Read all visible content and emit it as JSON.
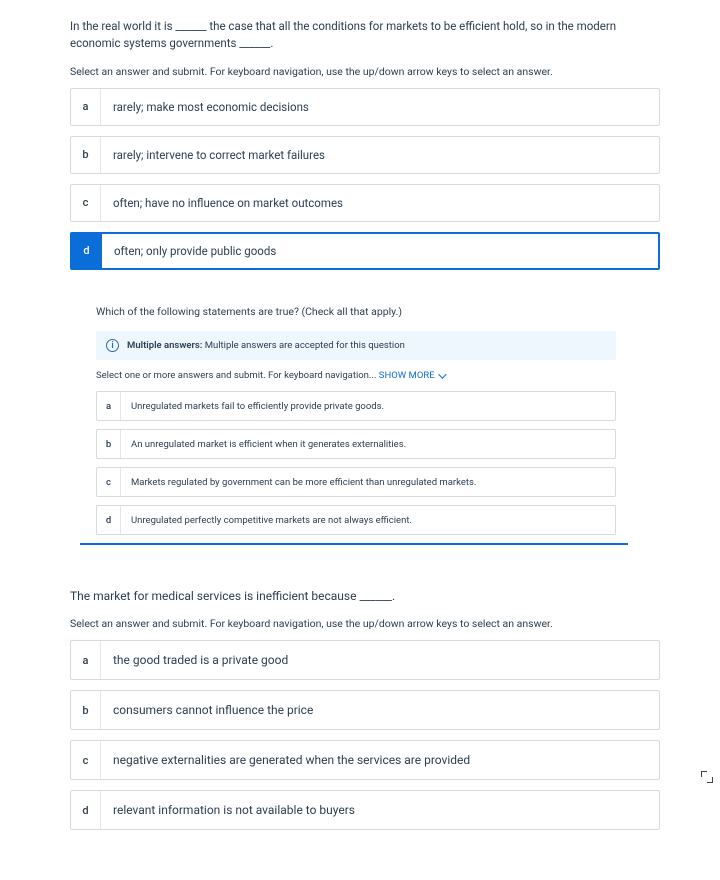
{
  "q1": {
    "prompt": "In the real world it is ______ the case that all the conditions for markets to be efficient hold, so in the modern economic systems governments ______.",
    "instructions": "Select an answer and submit. For keyboard navigation, use the up/down arrow keys to select an answer.",
    "options": {
      "a": {
        "letter": "a",
        "text": "rarely; make most economic decisions"
      },
      "b": {
        "letter": "b",
        "text": "rarely; intervene to correct market failures"
      },
      "c": {
        "letter": "c",
        "text": "often; have no influence on market outcomes"
      },
      "d": {
        "letter": "d",
        "text": "often; only provide public goods"
      }
    },
    "selected": "d"
  },
  "q2": {
    "prompt": "Which of the following statements are true? (Check all that apply.)",
    "banner_strong": "Multiple answers:",
    "banner_rest": " Multiple answers are accepted for this question",
    "instructions_prefix": "Select one or more answers and submit. For keyboard navigation... ",
    "show_more": "SHOW MORE",
    "options": {
      "a": {
        "letter": "a",
        "text": "Unregulated markets fail to efficiently provide private goods."
      },
      "b": {
        "letter": "b",
        "text": "An unregulated market is efficient when it generates externalities."
      },
      "c": {
        "letter": "c",
        "text": "Markets regulated by government can be more efficient than unregulated markets."
      },
      "d": {
        "letter": "d",
        "text": "Unregulated perfectly competitive markets are not always efficient."
      }
    }
  },
  "q3": {
    "prompt": "The market for medical services is inefficient because ______.",
    "instructions": "Select an answer and submit. For keyboard navigation, use the up/down arrow keys to select an answer.",
    "options": {
      "a": {
        "letter": "a",
        "text": "the good traded is a private good"
      },
      "b": {
        "letter": "b",
        "text": "consumers cannot influence the price"
      },
      "c": {
        "letter": "c",
        "text": "negative externalities are generated when the services are provided"
      },
      "d": {
        "letter": "d",
        "text": "relevant information is not available to buyers"
      }
    }
  }
}
